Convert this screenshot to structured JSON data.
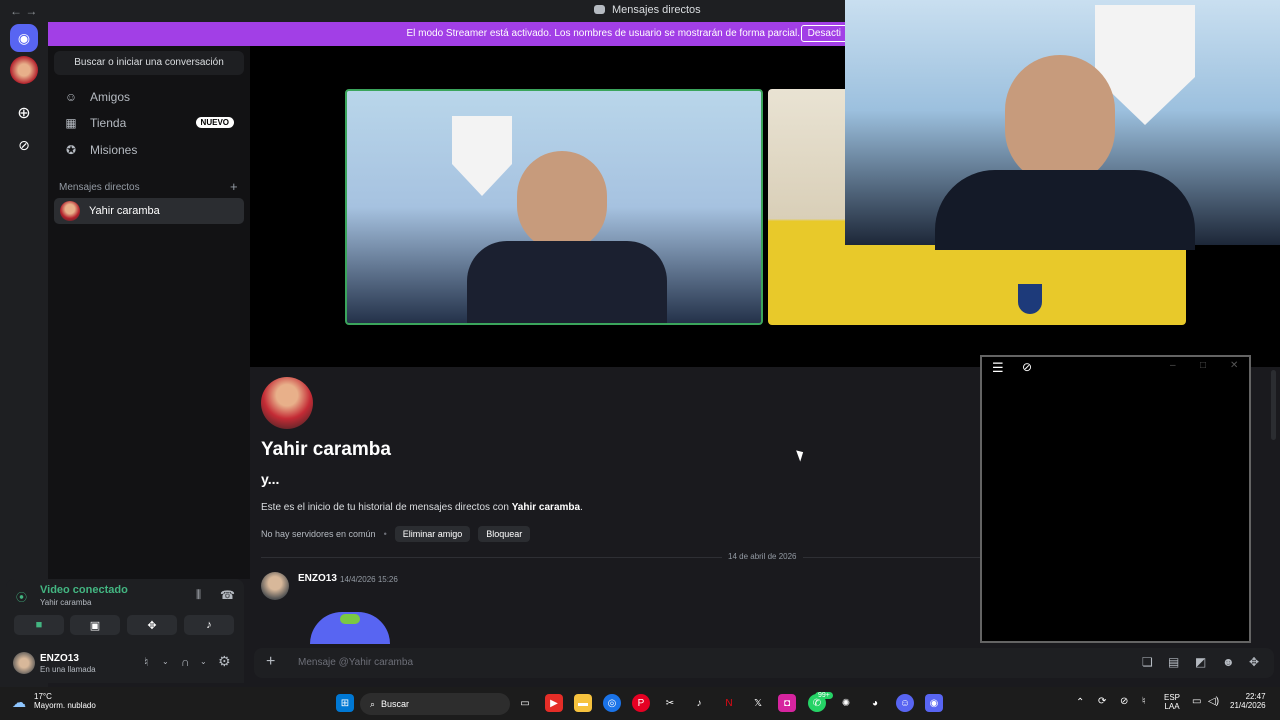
{
  "window": {
    "title": "Mensajes directos",
    "nav_back": "←",
    "nav_forward": "→"
  },
  "banner": {
    "text": "El modo Streamer está activado. Los nombres de usuario se mostrarán de forma parcial.",
    "button": "Desacti"
  },
  "sidebar": {
    "search_placeholder": "Buscar o iniciar una conversación",
    "items": [
      {
        "label": "Amigos",
        "icon": "friends-icon"
      },
      {
        "label": "Tienda",
        "icon": "shop-icon",
        "badge": "NUEVO"
      },
      {
        "label": "Misiones",
        "icon": "quests-icon"
      }
    ],
    "dm_header": "Mensajes directos",
    "dm_add": "+",
    "dm_active": "Yahir caramba"
  },
  "voice": {
    "status": "Video conectado",
    "channel": "Yahir caramba"
  },
  "user": {
    "name": "ENZO13",
    "status": "En una llamada"
  },
  "profile": {
    "name": "Yahir caramba",
    "status": "y...",
    "intro_prefix": "Este es el inicio de tu historial de mensajes directos con ",
    "intro_name": "Yahir caramba",
    "intro_suffix": ".",
    "mutual": "No hay servidores en común",
    "dot": "•",
    "remove_friend": "Eliminar amigo",
    "block": "Bloquear"
  },
  "messages": {
    "date_divider": "14 de abril de 2026",
    "author": "ENZO13",
    "timestamp": "14/4/2026 15:26"
  },
  "composer": {
    "placeholder": "Mensaje @Yahir caramba",
    "plus": "+"
  },
  "taskbar": {
    "temp": "17°C",
    "weather": "Mayorm. nublado",
    "search": "Buscar",
    "lang1": "ESP",
    "lang2": "LAA",
    "time": "22:47",
    "date": "21/4/2026",
    "notif_badge": "99+"
  },
  "colors": {
    "accent": "#5865f2",
    "streamer_banner": "#a23fe6",
    "connected": "#43b581"
  }
}
